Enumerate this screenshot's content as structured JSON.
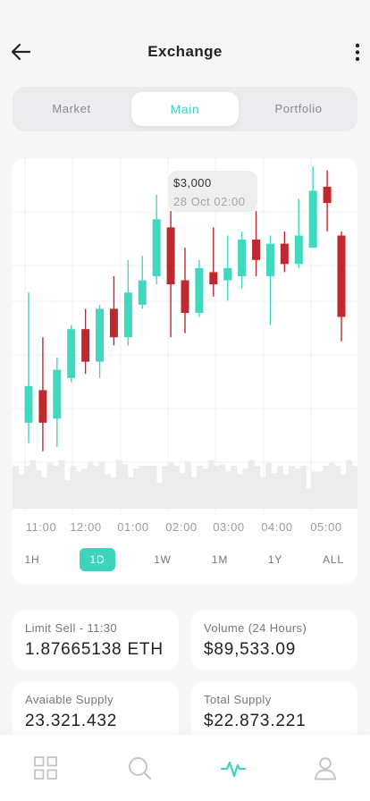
{
  "header": {
    "title": "Exchange",
    "back_icon": "arrow-left-icon",
    "more_icon": "more-vertical-icon"
  },
  "segments": [
    {
      "label": "Market",
      "active": false
    },
    {
      "label": "Main",
      "active": true
    },
    {
      "label": "Portfolio",
      "active": false
    }
  ],
  "colors": {
    "accent": "#3fd3bd",
    "up": "#40d9bf",
    "down": "#c02830",
    "volume": "#ececec"
  },
  "chart": {
    "tooltip": {
      "price": "$3,000",
      "date": "28 Oct 02:00"
    },
    "time_ticks": [
      "11:00",
      "12:00",
      "01:00",
      "02:00",
      "03:00",
      "04:00",
      "05:00"
    ],
    "ranges": [
      {
        "label": "1H",
        "active": false
      },
      {
        "label": "1D",
        "active": true
      },
      {
        "label": "1W",
        "active": false
      },
      {
        "label": "1M",
        "active": false
      },
      {
        "label": "1Y",
        "active": false
      },
      {
        "label": "ALL",
        "active": false
      }
    ]
  },
  "chart_data": {
    "type": "candlestick",
    "x": [
      "11:00",
      "12:00",
      "01:00",
      "02:00",
      "03:00",
      "04:00",
      "05:00"
    ],
    "candles": [
      {
        "open": 1150,
        "close": 1600,
        "high": 2750,
        "low": 900,
        "dir": "up"
      },
      {
        "open": 1550,
        "close": 1150,
        "high": 2200,
        "low": 800,
        "dir": "down"
      },
      {
        "open": 1200,
        "close": 1800,
        "high": 1950,
        "low": 850,
        "dir": "up"
      },
      {
        "open": 1700,
        "close": 2300,
        "high": 2350,
        "low": 1650,
        "dir": "up"
      },
      {
        "open": 2300,
        "close": 1900,
        "high": 2550,
        "low": 1750,
        "dir": "down"
      },
      {
        "open": 1900,
        "close": 2550,
        "high": 2600,
        "low": 1700,
        "dir": "up"
      },
      {
        "open": 2550,
        "close": 2200,
        "high": 2950,
        "low": 2100,
        "dir": "down"
      },
      {
        "open": 2200,
        "close": 2750,
        "high": 3150,
        "low": 2100,
        "dir": "up"
      },
      {
        "open": 2600,
        "close": 2900,
        "high": 3200,
        "low": 2550,
        "dir": "up"
      },
      {
        "open": 2950,
        "close": 3650,
        "high": 3950,
        "low": 2850,
        "dir": "up"
      },
      {
        "open": 3550,
        "close": 2850,
        "high": 3750,
        "low": 2200,
        "dir": "down"
      },
      {
        "open": 2900,
        "close": 2500,
        "high": 3300,
        "low": 2250,
        "dir": "down"
      },
      {
        "open": 2500,
        "close": 3050,
        "high": 3150,
        "low": 2450,
        "dir": "up"
      },
      {
        "open": 3000,
        "close": 2850,
        "high": 3550,
        "low": 2700,
        "dir": "down"
      },
      {
        "open": 2900,
        "close": 3050,
        "high": 3450,
        "low": 2650,
        "dir": "up"
      },
      {
        "open": 2950,
        "close": 3400,
        "high": 3500,
        "low": 2800,
        "dir": "up"
      },
      {
        "open": 3400,
        "close": 3150,
        "high": 3750,
        "low": 2950,
        "dir": "down"
      },
      {
        "open": 2950,
        "close": 3350,
        "high": 3450,
        "low": 2350,
        "dir": "up"
      },
      {
        "open": 3350,
        "close": 3100,
        "high": 3500,
        "low": 3000,
        "dir": "down"
      },
      {
        "open": 3100,
        "close": 3450,
        "high": 3900,
        "low": 3050,
        "dir": "up"
      },
      {
        "open": 3300,
        "close": 4000,
        "high": 4300,
        "low": 3300,
        "dir": "up"
      },
      {
        "open": 4050,
        "close": 3850,
        "high": 4250,
        "low": 3500,
        "dir": "down"
      },
      {
        "open": 3450,
        "close": 2450,
        "high": 3500,
        "low": 2150,
        "dir": "down"
      }
    ],
    "volume": [
      30,
      24,
      30,
      34,
      27,
      22,
      32,
      30,
      34,
      20,
      30,
      26,
      28,
      33,
      30,
      33,
      24,
      22,
      34,
      31,
      22,
      28,
      30,
      30,
      30,
      18,
      30,
      32,
      30,
      25,
      33,
      22,
      30,
      28,
      34,
      30,
      31,
      26,
      30,
      24,
      28,
      34,
      30,
      22,
      32,
      25,
      30,
      24,
      30,
      28,
      30,
      14,
      26,
      26,
      30,
      32,
      30,
      24,
      34,
      30
    ]
  },
  "stats": [
    {
      "label": "Limit Sell - 11:30",
      "value": "1.87665138 ETH"
    },
    {
      "label": "Volume (24 Hours)",
      "value": "$89,533.09"
    },
    {
      "label": "Avaiable Supply",
      "value": "23.321.432"
    },
    {
      "label": "Total Supply",
      "value": "$22.873.221"
    }
  ],
  "bottom_nav": [
    {
      "icon": "grid-icon",
      "active": false
    },
    {
      "icon": "search-icon",
      "active": false
    },
    {
      "icon": "activity-icon",
      "active": true
    },
    {
      "icon": "user-icon",
      "active": false
    }
  ]
}
